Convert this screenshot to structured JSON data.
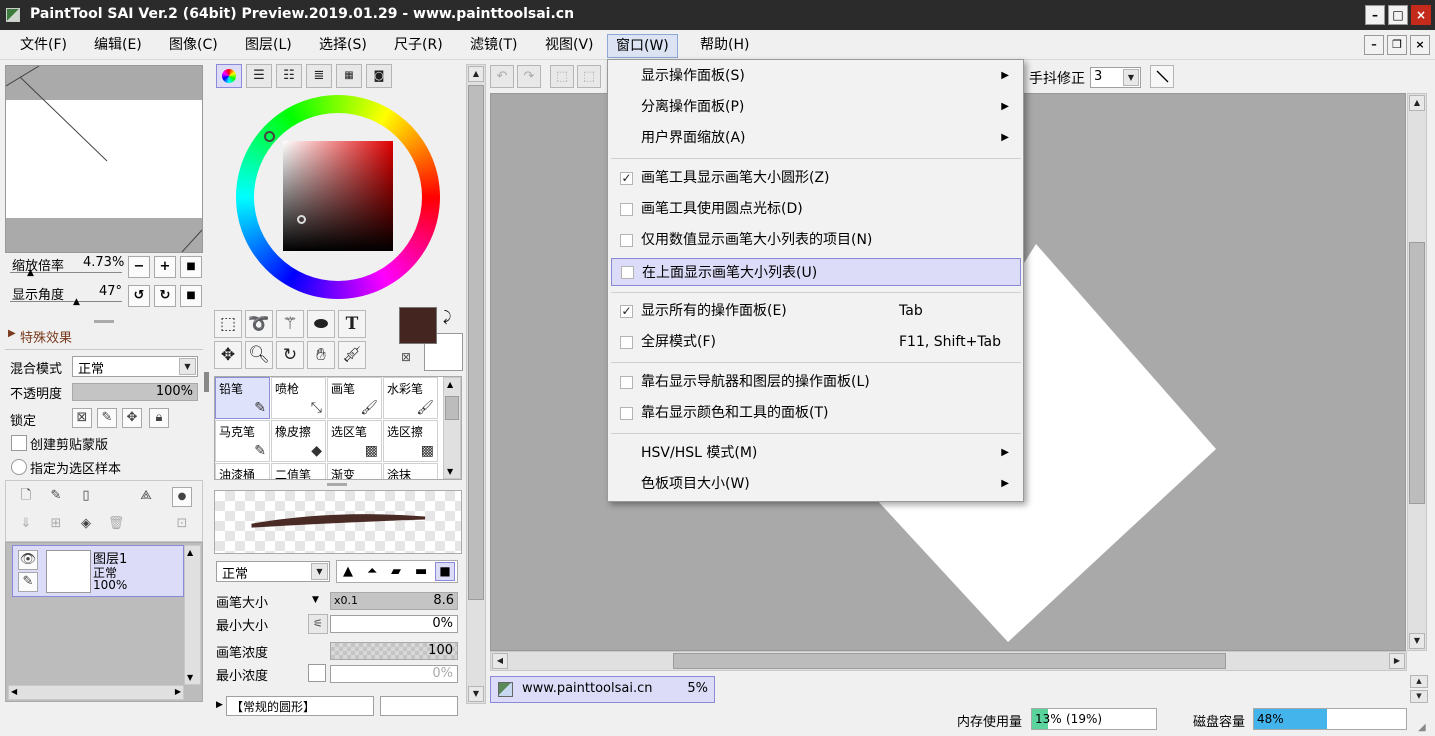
{
  "window": {
    "title": "PaintTool SAI Ver.2 (64bit) Preview.2019.01.29 - www.painttoolsai.cn"
  },
  "titlebar_buttons": {
    "minimize": "–",
    "maximize": "□",
    "close": "×"
  },
  "menubar": [
    "文件(F)",
    "编辑(E)",
    "图像(C)",
    "图层(L)",
    "选择(S)",
    "尺子(R)",
    "滤镜(T)",
    "视图(V)",
    "窗口(W)",
    "帮助(H)"
  ],
  "mdi_buttons": {
    "minimize": "–",
    "restore": "❐",
    "close": "×"
  },
  "navigator": {
    "zoom_label": "缩放倍率",
    "zoom_value": "4.73%",
    "angle_label": "显示角度",
    "angle_value": "47°"
  },
  "effects": {
    "header": "特殊效果"
  },
  "layer_props": {
    "blend_label": "混合模式",
    "blend_value": "正常",
    "opacity_label": "不透明度",
    "opacity_value": "100%",
    "lock_label": "锁定",
    "clip_label": "创建剪贴蒙版",
    "sample_label": "指定为选区样本"
  },
  "layers": [
    {
      "name": "图层1",
      "mode": "正常",
      "opacity": "100%"
    }
  ],
  "color": {
    "current": "#452520",
    "secondary": "#ffffff"
  },
  "brushes": [
    [
      "铅笔",
      "喷枪",
      "画笔",
      "水彩笔"
    ],
    [
      "马克笔",
      "橡皮擦",
      "选区笔",
      "选区擦"
    ],
    [
      "油漆桶",
      "二值笔",
      "渐变",
      "涂抹"
    ]
  ],
  "brush_settings": {
    "mode_value": "正常",
    "size_label": "画笔大小",
    "size_multiplier": "x0.1",
    "size_value": "8.6",
    "min_size_label": "最小大小",
    "min_size_value": "0%",
    "density_label": "画笔浓度",
    "density_value": "100",
    "min_density_label": "最小浓度",
    "min_density_value": "0%",
    "shape_dropdown": "【常规的圆形】"
  },
  "toolbar": {
    "stabilizer_label": "手抖修正",
    "stabilizer_value": "3"
  },
  "canvas_tab": {
    "name": "www.painttoolsai.cn",
    "zoom": "5%"
  },
  "status": {
    "memory_label": "内存使用量",
    "memory_value": "13%",
    "memory_extra": "(19%)",
    "memory_fraction": 0.13,
    "disk_label": "磁盘容量",
    "disk_value": "48%",
    "disk_fraction": 0.48
  },
  "dropdown_menu": {
    "items": [
      {
        "label": "显示操作面板(S)",
        "submenu": true
      },
      {
        "label": "分离操作面板(P)",
        "submenu": true
      },
      {
        "label": "用户界面缩放(A)",
        "submenu": true
      },
      {
        "label": "画笔工具显示画笔大小圆形(Z)",
        "checked": true
      },
      {
        "label": "画笔工具使用圆点光标(D)",
        "checked": false
      },
      {
        "label": "仅用数值显示画笔大小列表的项目(N)",
        "checked": false
      },
      {
        "label": "在上面显示画笔大小列表(U)",
        "checked": false,
        "highlighted": true
      },
      {
        "label": "显示所有的操作面板(E)",
        "checked": true,
        "shortcut": "Tab"
      },
      {
        "label": "全屏模式(F)",
        "checked": false,
        "shortcut": "F11, Shift+Tab"
      },
      {
        "label": "靠右显示导航器和图层的操作面板(L)",
        "checked": false
      },
      {
        "label": "靠右显示颜色和工具的面板(T)",
        "checked": false
      },
      {
        "label": "HSV/HSL 模式(M)",
        "submenu": true
      },
      {
        "label": "色板项目大小(W)",
        "submenu": true
      }
    ]
  }
}
